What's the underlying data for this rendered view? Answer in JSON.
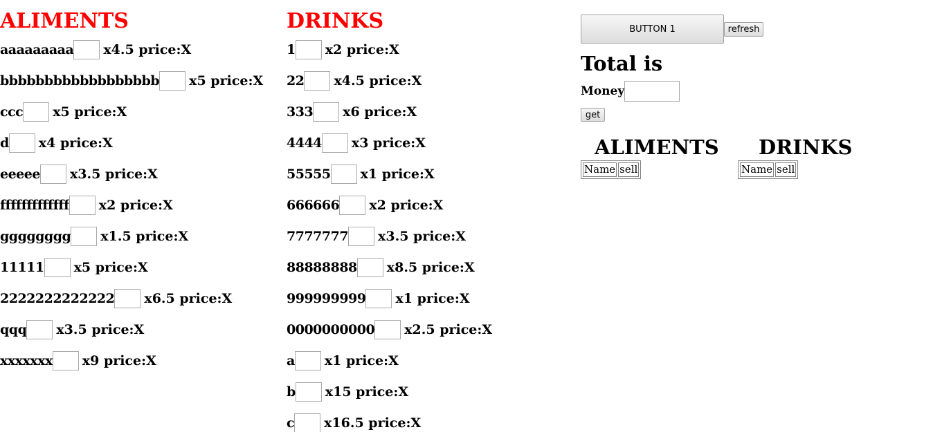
{
  "aliments": {
    "title": "ALIMENTS",
    "items": [
      {
        "name": "aaaaaaaaa",
        "meta": "x4.5 price:X"
      },
      {
        "name": "bbbbbbbbbbbbbbbbbb",
        "meta": "x5 price:X"
      },
      {
        "name": "ccc",
        "meta": "x5 price:X"
      },
      {
        "name": "d",
        "meta": "x4 price:X"
      },
      {
        "name": "eeeee",
        "meta": "x3.5 price:X"
      },
      {
        "name": "fffffffffffff",
        "meta": "x2 price:X"
      },
      {
        "name": "gggggggg",
        "meta": "x1.5 price:X"
      },
      {
        "name": "11111",
        "meta": "x5 price:X"
      },
      {
        "name": "2222222222222",
        "meta": "x6.5 price:X"
      },
      {
        "name": "qqq",
        "meta": "x3.5 price:X"
      },
      {
        "name": "xxxxxxx",
        "meta": "x9 price:X"
      }
    ]
  },
  "drinks": {
    "title": "DRINKS",
    "items": [
      {
        "name": "1",
        "meta": "x2 price:X"
      },
      {
        "name": "22",
        "meta": "x4.5 price:X"
      },
      {
        "name": "333",
        "meta": "x6 price:X"
      },
      {
        "name": "4444",
        "meta": "x3 price:X"
      },
      {
        "name": "55555",
        "meta": "x1 price:X"
      },
      {
        "name": "666666",
        "meta": "x2 price:X"
      },
      {
        "name": "7777777",
        "meta": "x3.5 price:X"
      },
      {
        "name": "88888888",
        "meta": "x8.5 price:X"
      },
      {
        "name": "999999999",
        "meta": "x1 price:X"
      },
      {
        "name": "0000000000",
        "meta": "x2.5 price:X"
      },
      {
        "name": "a",
        "meta": "x1 price:X"
      },
      {
        "name": "b",
        "meta": "x15 price:X"
      },
      {
        "name": "c",
        "meta": "x16.5 price:X"
      }
    ]
  },
  "controls": {
    "button1_label": "BUTTON 1",
    "refresh_label": "refresh",
    "total_label": "Total is",
    "money_label": "Money",
    "money_value": "",
    "get_label": "get"
  },
  "summary": {
    "aliments_title": "ALIMENTS",
    "drinks_title": "DRINKS",
    "headers": [
      "Name",
      "sell"
    ]
  }
}
